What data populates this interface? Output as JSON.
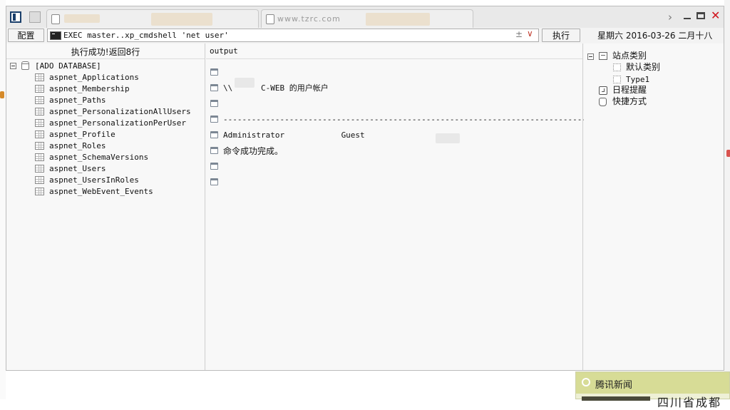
{
  "tabs": [
    {
      "label": ""
    },
    {
      "label": "www.tzrc.com"
    }
  ],
  "toolbar": {
    "config_label": "配置",
    "command_text": "EXEC master..xp_cmdshell 'net user'",
    "plus_minus": "±",
    "dropdown_glyph": "∨",
    "execute_label": "执行",
    "date_text": "星期六 2016-03-26 二月十八"
  },
  "left_panel": {
    "status": "执行成功!返回8行",
    "root_label": "[ADO DATABASE]",
    "tables": [
      "aspnet_Applications",
      "aspnet_Membership",
      "aspnet_Paths",
      "aspnet_PersonalizationAllUsers",
      "aspnet_PersonalizationPerUser",
      "aspnet_Profile",
      "aspnet_Roles",
      "aspnet_SchemaVersions",
      "aspnet_Users",
      "aspnet_UsersInRoles",
      "aspnet_WebEvent_Events"
    ]
  },
  "output": {
    "header": "output",
    "rows": [
      "",
      "\\\\      C-WEB 的用户帐户",
      "",
      "-------------------------------------------------------------------------------",
      "Administrator            Guest",
      "命令成功完成。",
      "",
      ""
    ]
  },
  "right_panel": {
    "site_category": "站点类别",
    "default_category": "默认类别",
    "type1": "Type1",
    "schedule": "日程提醒",
    "shortcuts": "快捷方式"
  },
  "news_popup": {
    "title": "腾讯新闻",
    "snippet": "四川省成都"
  },
  "colors": {
    "close": "#d0121b",
    "accent_dark": "#1a3f6b",
    "popup_header": "#d7dc96"
  }
}
